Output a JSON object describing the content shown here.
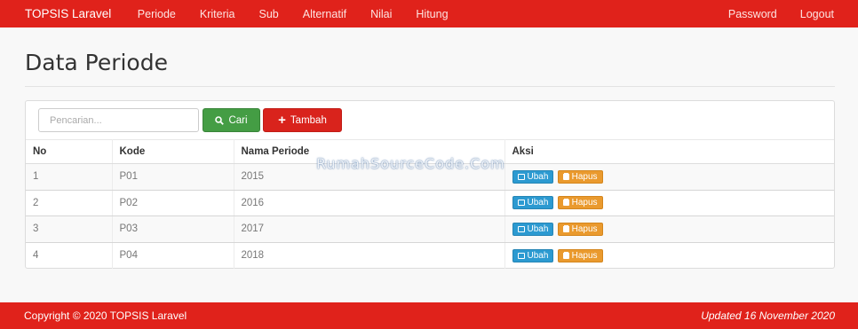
{
  "navbar": {
    "brand": "TOPSIS Laravel",
    "links": [
      "Periode",
      "Kriteria",
      "Sub",
      "Alternatif",
      "Nilai",
      "Hitung"
    ],
    "right_links": [
      "Password",
      "Logout"
    ]
  },
  "page": {
    "title": "Data Periode"
  },
  "toolbar": {
    "search_placeholder": "Pencarian...",
    "search_value": "",
    "cari_label": "Cari",
    "tambah_label": "Tambah"
  },
  "table": {
    "headers": [
      "No",
      "Kode",
      "Nama Periode",
      "Aksi"
    ],
    "rows": [
      {
        "no": "1",
        "kode": "P01",
        "nama": "2015"
      },
      {
        "no": "2",
        "kode": "P02",
        "nama": "2016"
      },
      {
        "no": "3",
        "kode": "P03",
        "nama": "2017"
      },
      {
        "no": "4",
        "kode": "P04",
        "nama": "2018"
      }
    ],
    "ubah_label": "Ubah",
    "hapus_label": "Hapus"
  },
  "watermark": "RumahSourceCode.Com",
  "footer": {
    "copyright": "Copyright © 2020 TOPSIS Laravel",
    "updated": "Updated 16 November 2020"
  },
  "colors": {
    "brand_red": "#e0221b",
    "success": "#449d44",
    "info": "#2c9ad1",
    "warning": "#ea9a2e"
  },
  "icons": {
    "cari": "search-icon",
    "tambah": "plus-icon",
    "ubah": "edit-icon",
    "hapus": "trash-icon"
  }
}
